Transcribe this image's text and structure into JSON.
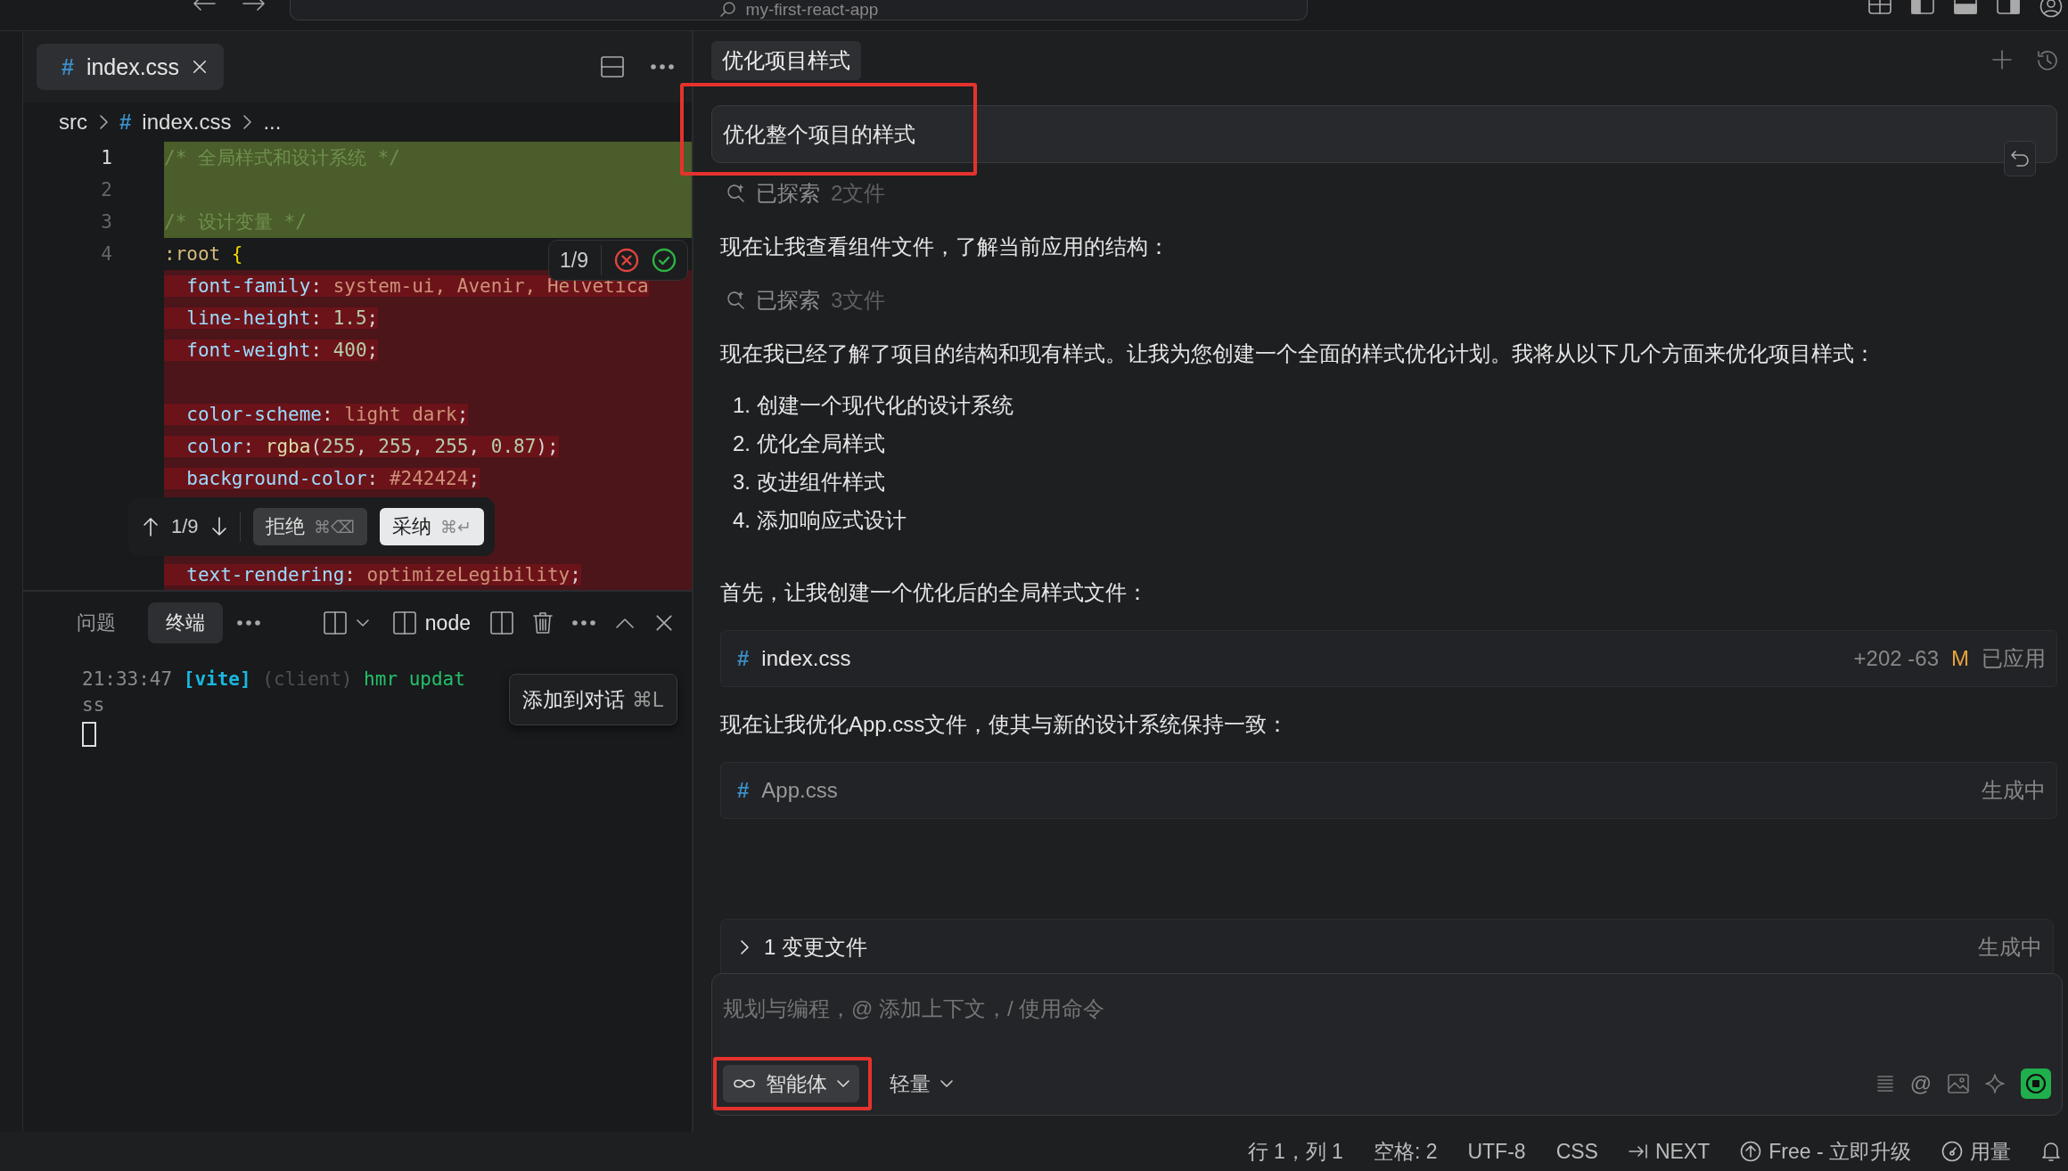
{
  "top_bar": {
    "search": {
      "value": "my-first-react-app"
    }
  },
  "editor": {
    "tabs": [
      {
        "icon_char": "#",
        "label": "index.css",
        "selected": true
      }
    ],
    "breadcrumb": [
      {
        "text": "src"
      },
      {
        "icon_char": "#",
        "text": "index.css"
      },
      {
        "text": "..."
      }
    ],
    "lines": [
      {
        "kind": "added",
        "number": "1",
        "tokens": [
          {
            "kind": "comment",
            "text": "/* 全局样式和设计系统 */"
          }
        ]
      },
      {
        "kind": "added",
        "number": "2"
      },
      {
        "kind": "added",
        "number": "3",
        "tokens": [
          {
            "kind": "comment",
            "text": "/* 设计变量 */"
          }
        ]
      },
      {
        "kind": "plain",
        "number": "4",
        "tokens": [
          {
            "kind": "selector",
            "text": ":root"
          },
          {
            "kind": "brace",
            "text": " {"
          }
        ]
      },
      {
        "kind": "deleted",
        "tokens": [
          {
            "kind": "prop",
            "text": "  font-family"
          },
          {
            "kind": "punct",
            "text": ": "
          },
          {
            "kind": "value",
            "text": "system-ui, Avenir, Helvetica"
          }
        ]
      },
      {
        "kind": "deleted",
        "tokens": [
          {
            "kind": "prop",
            "text": "  line-height"
          },
          {
            "kind": "punct",
            "text": ": "
          },
          {
            "kind": "number",
            "text": "1.5"
          },
          {
            "kind": "punct",
            "text": ";"
          }
        ]
      },
      {
        "kind": "deleted",
        "tokens": [
          {
            "kind": "prop",
            "text": "  font-weight"
          },
          {
            "kind": "punct",
            "text": ": "
          },
          {
            "kind": "number",
            "text": "400"
          },
          {
            "kind": "punct",
            "text": ";"
          }
        ]
      },
      {
        "kind": "deleted"
      },
      {
        "kind": "deleted",
        "tokens": [
          {
            "kind": "prop",
            "text": "  color-scheme"
          },
          {
            "kind": "punct",
            "text": ": "
          },
          {
            "kind": "value",
            "text": "light dark"
          },
          {
            "kind": "punct",
            "text": ";"
          }
        ]
      },
      {
        "kind": "deleted",
        "tokens": [
          {
            "kind": "prop",
            "text": "  color"
          },
          {
            "kind": "punct",
            "text": ": "
          },
          {
            "kind": "func",
            "text": "rgba"
          },
          {
            "kind": "punct",
            "text": "("
          },
          {
            "kind": "number",
            "text": "255"
          },
          {
            "kind": "punct",
            "text": ", "
          },
          {
            "kind": "number",
            "text": "255"
          },
          {
            "kind": "punct",
            "text": ", "
          },
          {
            "kind": "number",
            "text": "255"
          },
          {
            "kind": "punct",
            "text": ", "
          },
          {
            "kind": "number",
            "text": "0.87"
          },
          {
            "kind": "punct",
            "text": ");"
          }
        ]
      },
      {
        "kind": "deleted",
        "tokens": [
          {
            "kind": "prop",
            "text": "  background-color"
          },
          {
            "kind": "punct",
            "text": ": "
          },
          {
            "kind": "value",
            "text": "#242424"
          },
          {
            "kind": "punct",
            "text": ";"
          }
        ]
      },
      {
        "kind": "deleted"
      },
      {
        "kind": "deleted"
      },
      {
        "kind": "deleted",
        "tokens": [
          {
            "kind": "prop",
            "text": "  text-rendering"
          },
          {
            "kind": "punct",
            "text": ": "
          },
          {
            "kind": "value",
            "text": "optimizeLegibility"
          },
          {
            "kind": "punct",
            "text": ";"
          }
        ]
      }
    ],
    "change_widget": {
      "counter": "1/9"
    },
    "review_bar": {
      "counter": "1/9",
      "reject": {
        "label": "拒绝",
        "shortcut": "⌘⌫"
      },
      "accept": {
        "label": "采纳",
        "shortcut": "⌘↵"
      }
    }
  },
  "terminal": {
    "tabs": [
      {
        "label": "问题",
        "selected": false
      },
      {
        "label": "终端",
        "selected": true
      }
    ],
    "shell": "node",
    "lines": [
      {
        "tokens": [
          {
            "kind": "time",
            "text": "21:33:47 "
          },
          {
            "kind": "tag",
            "text": "[vite] "
          },
          {
            "kind": "dim",
            "text": "(client) "
          },
          {
            "kind": "ok",
            "text": "hmr updat"
          }
        ]
      },
      {
        "tokens": [
          {
            "kind": "time",
            "text": "ss"
          }
        ]
      }
    ],
    "tooltip": {
      "label": "添加到对话",
      "shortcut": "⌘L"
    }
  },
  "chat": {
    "tabs": [
      {
        "label": "优化项目样式",
        "selected": true
      }
    ],
    "user_message": "优化整个项目的样式",
    "messages": [
      {
        "kind": "explored",
        "label": "已探索",
        "count": "2文件"
      },
      {
        "kind": "text",
        "text": "现在让我查看组件文件，了解当前应用的结构："
      },
      {
        "kind": "explored",
        "label": "已探索",
        "count": "3文件"
      },
      {
        "kind": "text",
        "text": "现在我已经了解了项目的结构和现有样式。让我为您创建一个全面的样式优化计划。我将从以下几个方面来优化项目样式："
      },
      {
        "kind": "list",
        "items": [
          {
            "number": "1.",
            "text": "创建一个现代化的设计系统"
          },
          {
            "number": "2.",
            "text": "优化全局样式"
          },
          {
            "number": "3.",
            "text": "改进组件样式"
          },
          {
            "number": "4.",
            "text": "添加响应式设计"
          }
        ]
      },
      {
        "kind": "text",
        "text": "首先，让我创建一个优化后的全局样式文件："
      },
      {
        "kind": "file",
        "icon_char": "#",
        "name": "index.css",
        "additions": "+202",
        "deletions": "-63",
        "badge": "M",
        "status": "已应用",
        "pending": false
      },
      {
        "kind": "text",
        "text": "现在让我优化App.css文件，使其与新的设计系统保持一致："
      },
      {
        "kind": "file",
        "icon_char": "#",
        "name": "App.css",
        "status": "生成中",
        "pending": true
      }
    ],
    "changes_bar": {
      "label": "1 变更文件",
      "status": "生成中",
      "expanded": false
    },
    "composer": {
      "placeholder": "规划与编程，@ 添加上下文，/ 使用命令",
      "mode": "智能体",
      "model": "轻量",
      "at_char": "@"
    }
  },
  "status_bar": [
    {
      "kind": "text",
      "text": "行 1，列 1"
    },
    {
      "kind": "text",
      "text": "空格: 2"
    },
    {
      "kind": "text",
      "text": "UTF-8"
    },
    {
      "kind": "text",
      "text": "CSS"
    },
    {
      "kind": "next",
      "text": "NEXT"
    },
    {
      "kind": "upgrade",
      "text": "Free - 立即升级"
    },
    {
      "kind": "usage",
      "text": "用量"
    },
    {
      "kind": "bell"
    }
  ]
}
